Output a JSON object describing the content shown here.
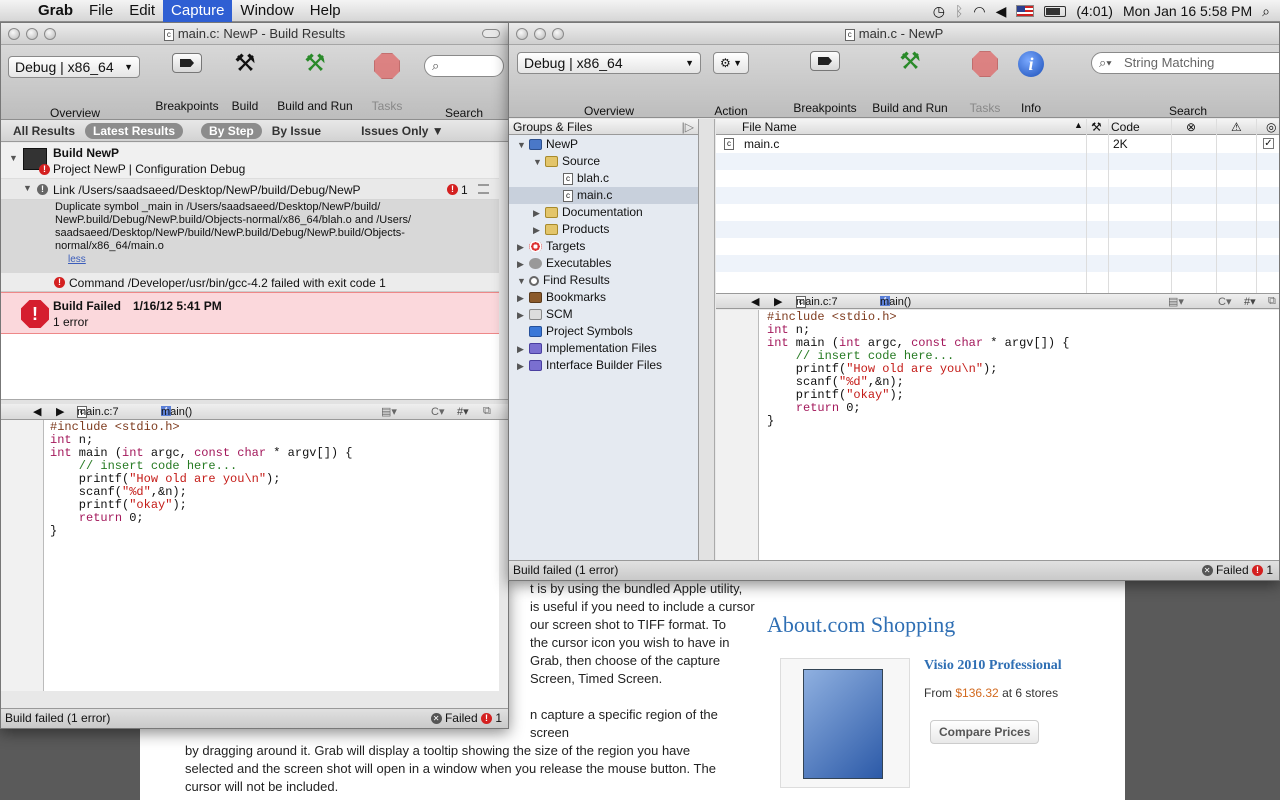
{
  "menubar": {
    "app": "Grab",
    "menus": [
      "File",
      "Edit",
      "Capture",
      "Window",
      "Help"
    ],
    "active_menu": "Capture",
    "battery": "(4:01)",
    "clock": "Mon Jan 16  5:58 PM"
  },
  "webpage": {
    "article_lines": [
      "t is by using the bundled Apple utility,",
      "is useful if you need to include a cursor",
      "our screen shot to TIFF format. To",
      "the cursor icon you wish to have in",
      "Grab, then choose of the capture",
      "Screen, Timed Screen.",
      "",
      "n capture a specific region of the screen",
      "by dragging around it. Grab will display a tooltip showing the size of the region you have",
      "selected and the screen shot will open in a window when you release the mouse button. The",
      "cursor will not be included."
    ],
    "aside_title": "About.com Shopping",
    "product_name": "Visio 2010 Professional",
    "price_prefix": "From ",
    "price_amount": "$136.32",
    "price_suffix": " at 6 stores",
    "compare_label": "Compare Prices"
  },
  "left_window": {
    "title": "main.c: NewP - Build Results",
    "config": "Debug | x86_64",
    "toolbar": {
      "overview": "Overview",
      "breakpoints": "Breakpoints",
      "build": "Build",
      "build_and_run": "Build and Run",
      "tasks": "Tasks",
      "search": "Search"
    },
    "scope": {
      "all_results": "All Results",
      "latest_results": "Latest Results",
      "by_step": "By Step",
      "by_issue": "By Issue",
      "issues_only": "Issues Only"
    },
    "results": {
      "build_title": "Build NewP",
      "build_sub": "Project NewP | Configuration Debug",
      "link_line": "Link /Users/saadsaeed/Desktop/NewP/build/Debug/NewP",
      "link_count": "1",
      "dup_lines": [
        "Duplicate symbol _main in /Users/saadsaeed/Desktop/NewP/build/",
        "NewP.build/Debug/NewP.build/Objects-normal/x86_64/blah.o and /Users/",
        "saadsaeed/Desktop/NewP/build/NewP.build/Debug/NewP.build/Objects-",
        "normal/x86_64/main.o"
      ],
      "less": "less",
      "command_line": "Command /Developer/usr/bin/gcc-4.2 failed with exit code 1",
      "failed_title": "Build Failed",
      "failed_time": "1/16/12 5:41 PM",
      "failed_sub": "1 error"
    },
    "nav": {
      "file": "main.c:7",
      "symbol": "main()"
    },
    "status": "Build failed (1 error)",
    "status_failed": "Failed",
    "status_count": "1"
  },
  "right_window": {
    "title": "main.c - NewP",
    "config": "Debug | x86_64",
    "toolbar": {
      "overview": "Overview",
      "action": "Action",
      "breakpoints": "Breakpoints",
      "build_and_run": "Build and Run",
      "tasks": "Tasks",
      "info": "Info",
      "search": "Search",
      "search_placeholder": "String Matching"
    },
    "groups_header": "Groups & Files",
    "tree": [
      "NewP",
      "Source",
      "blah.c",
      "main.c",
      "Documentation",
      "Products",
      "Targets",
      "Executables",
      "Find Results",
      "Bookmarks",
      "SCM",
      "Project Symbols",
      "Implementation Files",
      "Interface Builder Files"
    ],
    "table": {
      "col_file": "File Name",
      "col_code": "Code",
      "row_file": "main.c",
      "row_code": "2K"
    },
    "nav": {
      "file": "main.c:7",
      "symbol": "main()"
    },
    "status": "Build failed (1 error)",
    "status_failed": "Failed",
    "status_count": "1"
  },
  "code": {
    "line1": "#include <stdio.h>",
    "line2": "int n;",
    "line3a": "int",
    "line3b": " main (",
    "line3c": "int",
    "line3d": " argc, ",
    "line3e": "const char",
    "line3f": " * argv[]) {",
    "line4": "    // insert code here...",
    "line5a": "    printf(",
    "line5b": "\"How old are you\\n\"",
    "line5c": ");",
    "line6a": "    scanf(",
    "line6b": "\"%d\"",
    "line6c": ",&n);",
    "line7a": "    printf(",
    "line7b": "\"okay\"",
    "line7c": ");",
    "line8a": "    ",
    "line8b": "return",
    "line8c": " 0;",
    "line9": "}"
  }
}
